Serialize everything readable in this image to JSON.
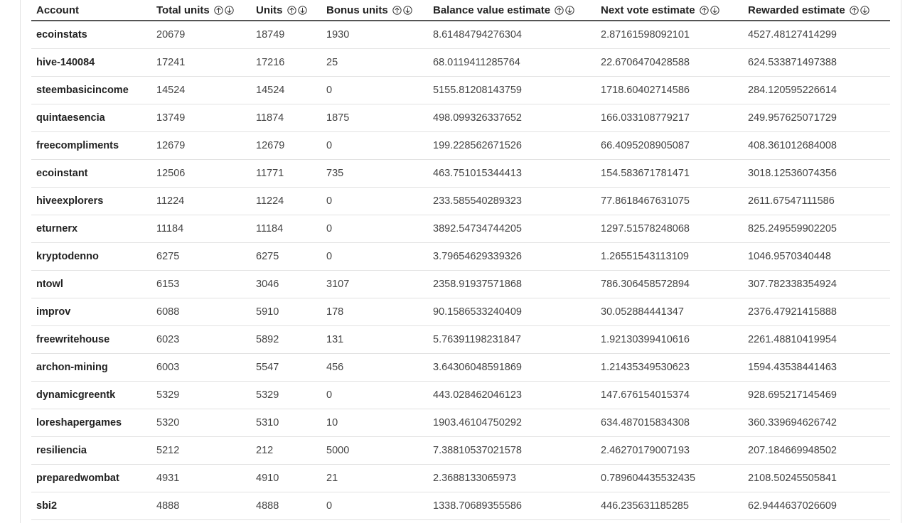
{
  "table": {
    "columns": [
      {
        "label": "Account",
        "sortable": false
      },
      {
        "label": "Total units",
        "sortable": true
      },
      {
        "label": "Units",
        "sortable": true
      },
      {
        "label": "Bonus units",
        "sortable": true
      },
      {
        "label": "Balance value estimate",
        "sortable": true
      },
      {
        "label": "Next vote estimate",
        "sortable": true
      },
      {
        "label": "Rewarded estimate",
        "sortable": true
      }
    ],
    "sort_icons": {
      "up": "arrow-up-circle-icon",
      "down": "arrow-down-circle-icon"
    },
    "rows": [
      [
        "ecoinstats",
        "20679",
        "18749",
        "1930",
        "8.61484794276304",
        "2.87161598092101",
        "4527.48127414299"
      ],
      [
        "hive-140084",
        "17241",
        "17216",
        "25",
        "68.0119411285764",
        "22.6706470428588",
        "624.533871497388"
      ],
      [
        "steembasicincome",
        "14524",
        "14524",
        "0",
        "5155.81208143759",
        "1718.60402714586",
        "284.120595226614"
      ],
      [
        "quintaesencia",
        "13749",
        "11874",
        "1875",
        "498.099326337652",
        "166.033108779217",
        "249.957625071729"
      ],
      [
        "freecompliments",
        "12679",
        "12679",
        "0",
        "199.228562671526",
        "66.4095208905087",
        "408.361012684008"
      ],
      [
        "ecoinstant",
        "12506",
        "11771",
        "735",
        "463.751015344413",
        "154.583671781471",
        "3018.12536074356"
      ],
      [
        "hiveexplorers",
        "11224",
        "11224",
        "0",
        "233.585540289323",
        "77.8618467631075",
        "2611.67547111586"
      ],
      [
        "eturnerx",
        "11184",
        "11184",
        "0",
        "3892.54734744205",
        "1297.51578248068",
        "825.249559902205"
      ],
      [
        "kryptodenno",
        "6275",
        "6275",
        "0",
        "3.79654629339326",
        "1.26551543113109",
        "1046.9570340448"
      ],
      [
        "ntowl",
        "6153",
        "3046",
        "3107",
        "2358.91937571868",
        "786.306458572894",
        "307.782338354924"
      ],
      [
        "improv",
        "6088",
        "5910",
        "178",
        "90.1586533240409",
        "30.052884441347",
        "2376.47921415888"
      ],
      [
        "freewritehouse",
        "6023",
        "5892",
        "131",
        "5.76391198231847",
        "1.92130399410616",
        "2261.48810419954"
      ],
      [
        "archon-mining",
        "6003",
        "5547",
        "456",
        "3.64306048591869",
        "1.21435349530623",
        "1594.43538441463"
      ],
      [
        "dynamicgreentk",
        "5329",
        "5329",
        "0",
        "443.028462046123",
        "147.676154015374",
        "928.695217145469"
      ],
      [
        "loreshapergames",
        "5320",
        "5310",
        "10",
        "1903.46104750292",
        "634.487015834308",
        "360.339694626742"
      ],
      [
        "resiliencia",
        "5212",
        "212",
        "5000",
        "7.38810537021578",
        "2.46270179007193",
        "207.184669948502"
      ],
      [
        "preparedwombat",
        "4931",
        "4910",
        "21",
        "2.3688133065973",
        "0.789604435532435",
        "2108.50245505841"
      ],
      [
        "sbi2",
        "4888",
        "4888",
        "0",
        "1338.70689355586",
        "446.235631185285",
        "62.9444637026609"
      ]
    ]
  }
}
